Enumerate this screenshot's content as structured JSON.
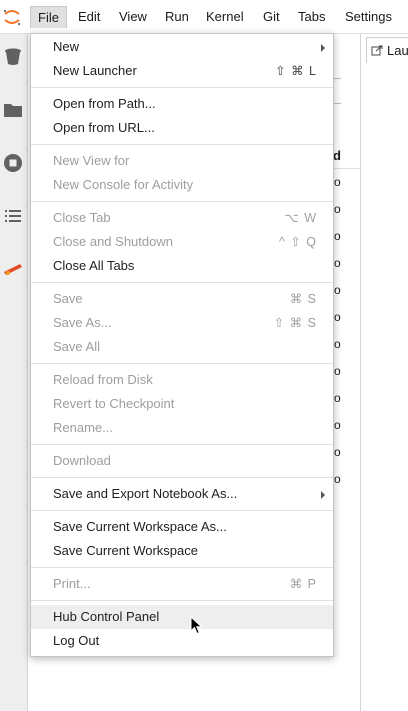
{
  "menubar": {
    "items": [
      "File",
      "Edit",
      "View",
      "Run",
      "Kernel",
      "Git",
      "Tabs",
      "Settings"
    ],
    "active": "File"
  },
  "main": {
    "launcher_tab": "Lau"
  },
  "file_browser": {
    "column_header": "d",
    "cells": [
      "o",
      "o",
      "o",
      "o",
      "o",
      "o",
      "o",
      "o",
      "o",
      "o",
      "o",
      "o"
    ]
  },
  "file_menu": {
    "items": [
      {
        "label": "New",
        "shortcut": "",
        "submenu": true,
        "disabled": false
      },
      {
        "label": "New Launcher",
        "shortcut": "⇧ ⌘ L",
        "disabled": false
      },
      {
        "label": "Open from Path...",
        "shortcut": "",
        "disabled": false
      },
      {
        "label": "Open from URL...",
        "shortcut": "",
        "disabled": false
      },
      {
        "label": "New View for",
        "shortcut": "",
        "disabled": true
      },
      {
        "label": "New Console for Activity",
        "shortcut": "",
        "disabled": true
      },
      {
        "label": "Close Tab",
        "shortcut": "⌥ W",
        "disabled": true
      },
      {
        "label": "Close and Shutdown",
        "shortcut": "^ ⇧ Q",
        "disabled": true
      },
      {
        "label": "Close All Tabs",
        "shortcut": "",
        "disabled": false
      },
      {
        "label": "Save",
        "shortcut": "⌘ S",
        "disabled": true
      },
      {
        "label": "Save As...",
        "shortcut": "⇧ ⌘ S",
        "disabled": true
      },
      {
        "label": "Save All",
        "shortcut": "",
        "disabled": true
      },
      {
        "label": "Reload from Disk",
        "shortcut": "",
        "disabled": true
      },
      {
        "label": "Revert to Checkpoint",
        "shortcut": "",
        "disabled": true
      },
      {
        "label": "Rename...",
        "shortcut": "",
        "disabled": true
      },
      {
        "label": "Download",
        "shortcut": "",
        "disabled": true
      },
      {
        "label": "Save and Export Notebook As...",
        "shortcut": "",
        "submenu": true,
        "disabled": false
      },
      {
        "label": "Save Current Workspace As...",
        "shortcut": "",
        "disabled": false
      },
      {
        "label": "Save Current Workspace",
        "shortcut": "",
        "disabled": false
      },
      {
        "label": "Print...",
        "shortcut": "⌘ P",
        "disabled": true
      },
      {
        "label": "Hub Control Panel",
        "shortcut": "",
        "disabled": false,
        "hovered": true
      },
      {
        "label": "Log Out",
        "shortcut": "",
        "disabled": false
      }
    ]
  },
  "icons": {
    "logo": "jupyter-logo-icon",
    "leftbar": [
      "trash-icon",
      "folder-icon",
      "stop-circle-icon",
      "list-icon",
      "extension-icon"
    ]
  },
  "colors": {
    "logo": "#f37726",
    "extension": "#e34c26",
    "hover": "#eeeeee"
  }
}
